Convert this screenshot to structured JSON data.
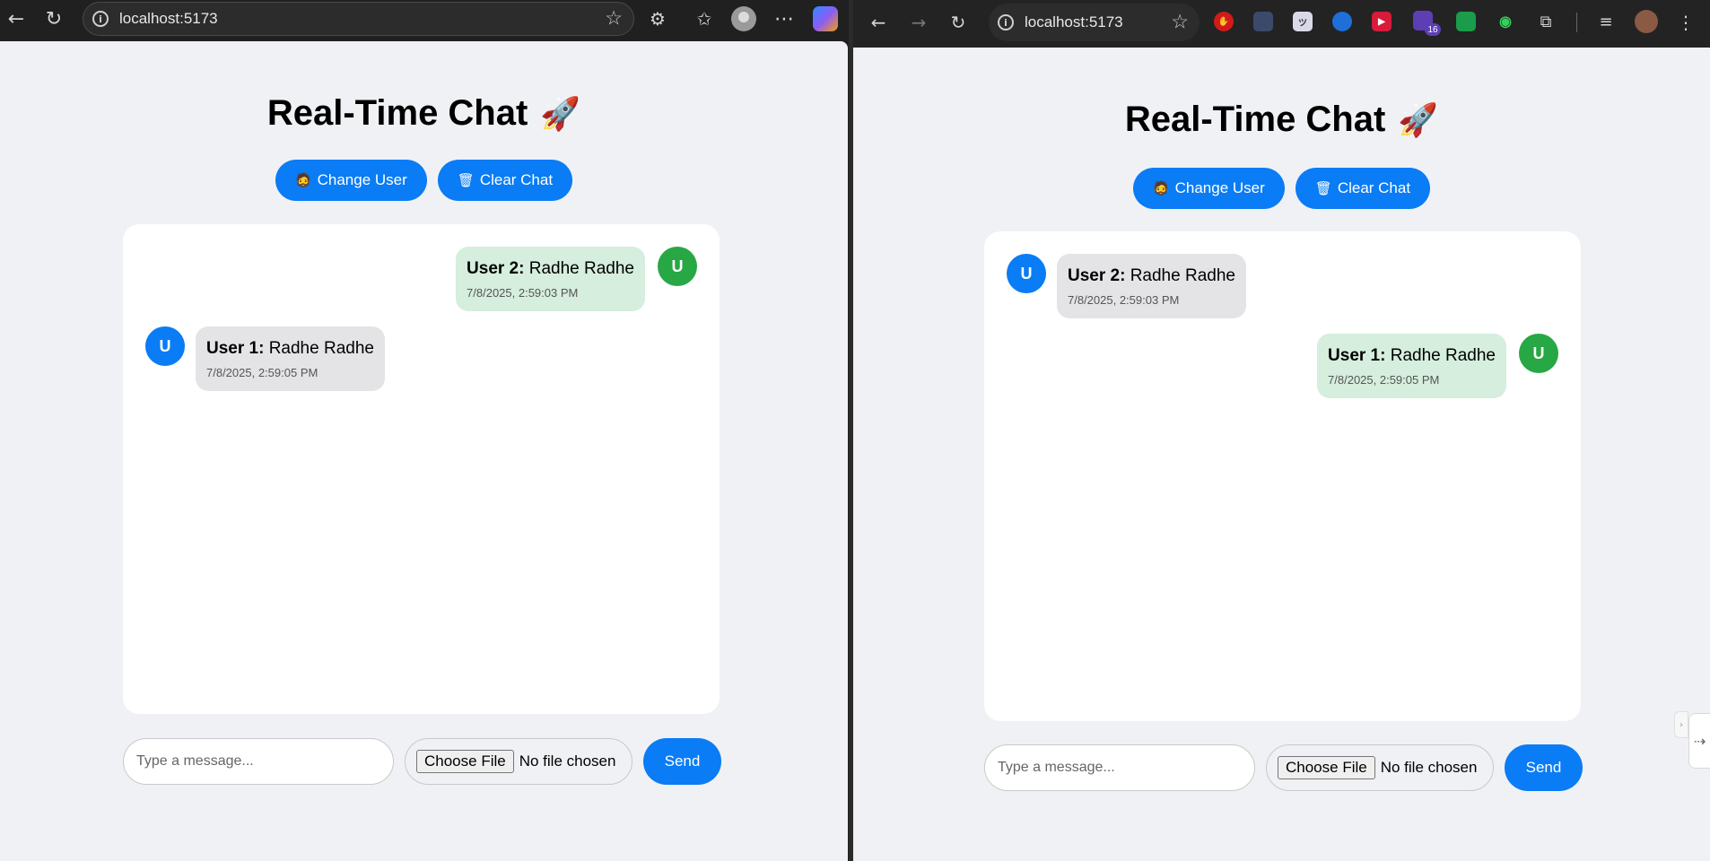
{
  "left_window": {
    "address": "localhost:5173",
    "toolbar_icons": [
      "back-icon",
      "refresh-icon",
      "info-icon",
      "favorite-star-icon",
      "extensions-icon",
      "favorites-icon",
      "profile-icon",
      "more-icon",
      "copilot-icon"
    ]
  },
  "right_window": {
    "address": "localhost:5173",
    "extension_badge": "16",
    "toolbar_icons": [
      "back-icon",
      "forward-icon",
      "reload-icon",
      "info-icon",
      "bookmark-star-icon",
      "extension-icons",
      "puzzle-icon",
      "reading-list-icon",
      "profile-avatar-icon",
      "more-icon"
    ]
  },
  "app": {
    "title": "Real-Time Chat",
    "title_emoji": "🚀",
    "change_user_emoji": "🧔",
    "change_user_label": "Change User",
    "clear_chat_emoji": "🗑",
    "clear_chat_label": "Clear Chat",
    "input_placeholder": "Type a message...",
    "file_button_label": "Choose File",
    "file_status": "No file chosen",
    "send_label": "Send"
  },
  "left_messages": [
    {
      "avatar": "U",
      "user": "User 2:",
      "text": "Radhe Radhe",
      "time": "7/8/2025, 2:59:03 PM",
      "side": "right",
      "avatar_color": "#28a745",
      "bubble_color": "#d5eedd"
    },
    {
      "avatar": "U",
      "user": "User 1:",
      "text": "Radhe Radhe",
      "time": "7/8/2025, 2:59:05 PM",
      "side": "left",
      "avatar_color": "#0a7cf5",
      "bubble_color": "#e4e4e6"
    }
  ],
  "right_messages": [
    {
      "avatar": "U",
      "user": "User 2:",
      "text": "Radhe Radhe",
      "time": "7/8/2025, 2:59:03 PM",
      "side": "left",
      "avatar_color": "#0a7cf5",
      "bubble_color": "#e4e4e6"
    },
    {
      "avatar": "U",
      "user": "User 1:",
      "text": "Radhe Radhe",
      "time": "7/8/2025, 2:59:05 PM",
      "side": "right",
      "avatar_color": "#28a745",
      "bubble_color": "#d5eedd"
    }
  ],
  "colors": {
    "accent": "#0a7cf5",
    "page_background": "#f0f1f5",
    "sent_bubble": "#d5eedd",
    "received_bubble": "#e4e4e6"
  }
}
